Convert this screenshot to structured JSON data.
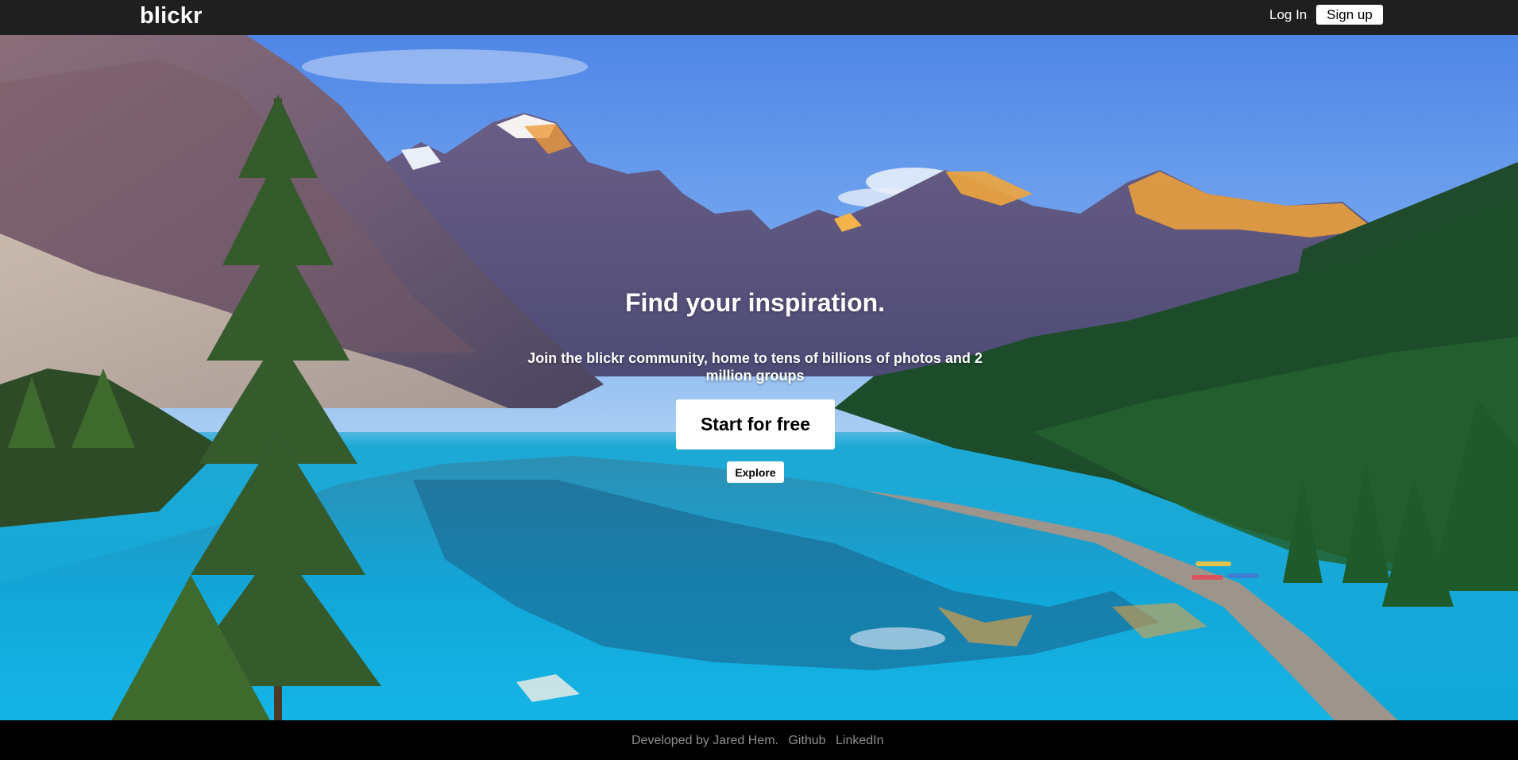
{
  "header": {
    "logo": "blickr",
    "login_label": "Log In",
    "signup_label": "Sign up"
  },
  "hero": {
    "headline": "Find your inspiration.",
    "subline": "Join the blickr community, home to tens of billions of photos and 2 million groups",
    "start_label": "Start for free",
    "explore_label": "Explore",
    "background_description_icon": "mountain-lake-photo"
  },
  "footer": {
    "credit": "Developed by Jared Hem.",
    "github_label": "Github",
    "linkedin_label": "LinkedIn"
  },
  "colors": {
    "topbar": "#1f1f20",
    "footer_bg": "#000000",
    "footer_text": "#8f8f8f",
    "button_bg": "#ffffff"
  }
}
